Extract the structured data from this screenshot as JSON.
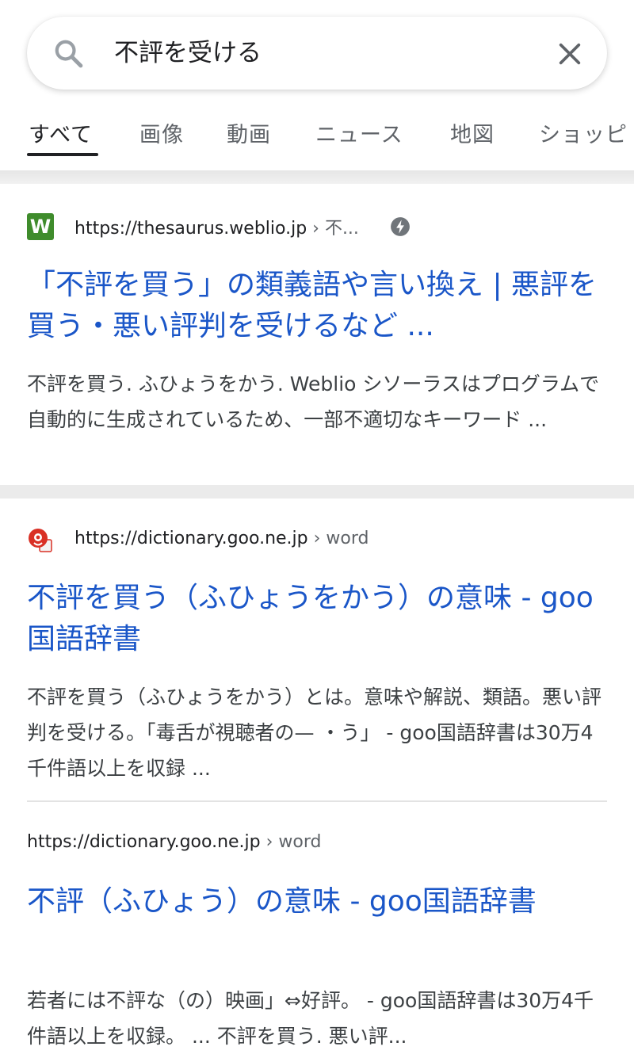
{
  "search": {
    "query": "不評を受ける"
  },
  "tabs": [
    {
      "label": "すべて",
      "active": true
    },
    {
      "label": "画像"
    },
    {
      "label": "動画"
    },
    {
      "label": "ニュース"
    },
    {
      "label": "地図"
    },
    {
      "label": "ショッピ"
    }
  ],
  "results": [
    {
      "favicon": "W",
      "url_domain": "https://thesaurus.weblio.jp",
      "url_path": " › 不...",
      "amp": "amp-lightning-icon",
      "title": "「不評を買う」の類義語や言い換え | 悪評を買う・悪い評判を受けるなど ...",
      "snippet": "不評を買う. ふひょうをかう. Weblio シソーラスはプログラムで自動的に生成されているため、一部不適切なキーワード ..."
    },
    {
      "favicon": "goo-icon",
      "url_domain": "https://dictionary.goo.ne.jp",
      "url_path": " › word",
      "title": "不評を買う（ふひょうをかう）の意味 - goo国語辞書",
      "snippet": "不評を買う（ふひょうをかう）とは。意味や解説、類語。悪い評判を受ける。「毒舌が視聴者の— ・う」 - goo国語辞書は30万4千件語以上を収録 ..."
    },
    {
      "url_domain": "https://dictionary.goo.ne.jp",
      "url_path": " › word",
      "title": "不評（ふひょう）の意味 - goo国語辞書",
      "snippet": "若者には不評な（の）映画」⇔好評。 - goo国語辞書は30万4千件語以上を収録。 ... 不評を買う. 悪い評..."
    }
  ],
  "colors": {
    "link": "#1a56c8",
    "favicon_weblio": "#3f8c2c",
    "favicon_goo": "#d93025"
  }
}
